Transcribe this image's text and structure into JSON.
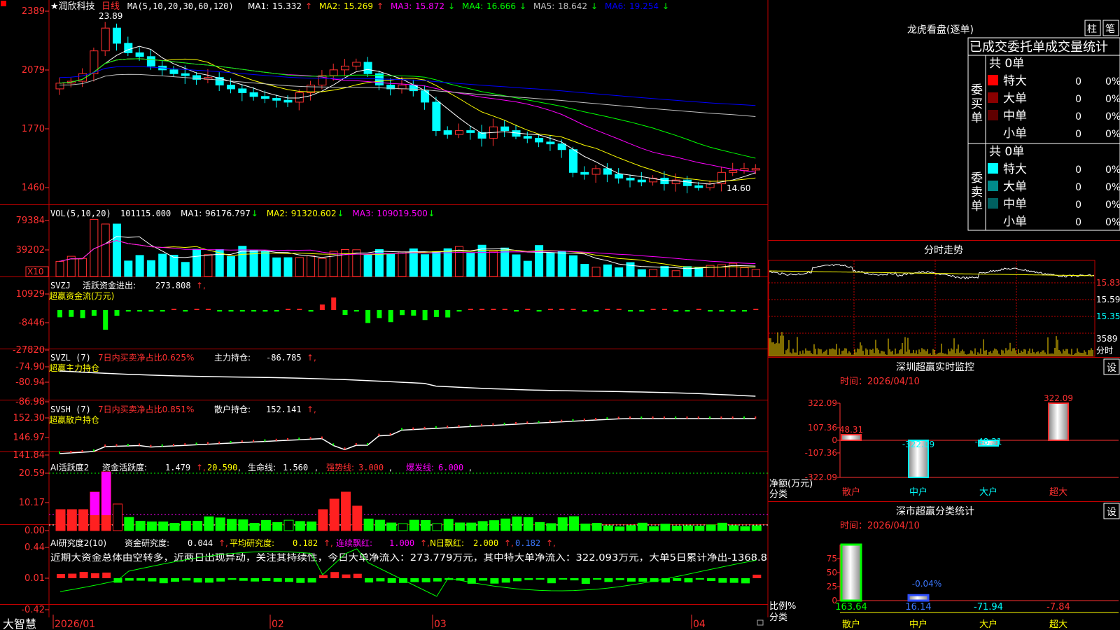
{
  "colors": {
    "up": "#ff3030",
    "down": "#00ffff",
    "vol_up": "#ff3030",
    "vol_down": "#00ffff",
    "ma1": "#ffffff",
    "ma2": "#ffff00",
    "ma3": "#ff00ff",
    "ma4": "#00ff00",
    "ma5": "#c0c0c0",
    "ma6": "#0000ff",
    "pos": "#ff2020",
    "neg": "#00ff00",
    "axis_text": "#ff3030",
    "border": "#ff0000"
  },
  "main": {
    "title": "★润欣科技",
    "period": "日线",
    "ma_header": "MA(5,10,20,30,60,120)",
    "ma": [
      {
        "label": "MA1:",
        "value": "15.332",
        "arrow": "↑",
        "color": "#ffffff"
      },
      {
        "label": "MA2:",
        "value": "15.269",
        "arrow": "↑",
        "color": "#ffff00"
      },
      {
        "label": "MA3:",
        "value": "15.872",
        "arrow": "↓",
        "color": "#ff00ff"
      },
      {
        "label": "MA4:",
        "value": "16.666",
        "arrow": "↓",
        "color": "#00ff00"
      },
      {
        "label": "MA5:",
        "value": "18.642",
        "arrow": "↓",
        "color": "#c0c0c0"
      },
      {
        "label": "MA6:",
        "value": "19.254",
        "arrow": "↓",
        "color": "#0000ff"
      }
    ],
    "y_ticks": [
      "2389",
      "2079",
      "1770",
      "1460"
    ],
    "high_label": "23.89",
    "low_label": "14.60"
  },
  "vol": {
    "header": "VOL(5,10,20)",
    "value": "101115.000",
    "ma": [
      {
        "label": "MA1:",
        "value": "96176.797",
        "arrow": "↓",
        "color": "#ffffff"
      },
      {
        "label": "MA2:",
        "value": "91320.602",
        "arrow": "↓",
        "color": "#ffff00"
      },
      {
        "label": "MA3:",
        "value": "109019.500",
        "arrow": "↓",
        "color": "#ff00ff"
      }
    ],
    "y_ticks": [
      "79384",
      "39202"
    ],
    "unit": "X10"
  },
  "svzj": {
    "header": "SVZJ",
    "label": "活跃资金进出:",
    "value": "273.808",
    "subtitle": "超赢资金流(万元)",
    "y_ticks": [
      "10929",
      "-8446",
      "-27820"
    ]
  },
  "svzl": {
    "header": "SVZL (7)",
    "stat": "7日内买卖净占比0.625%",
    "label": "主力持仓:",
    "value": "-86.785",
    "subtitle": "超赢主力持仓",
    "y_ticks": [
      "-74.90",
      "-80.94",
      "-86.98"
    ]
  },
  "svsh": {
    "header": "SVSH (7)",
    "stat": "7日内买卖净占比0.851%",
    "label": "散户持仓:",
    "value": "152.141",
    "subtitle": "超赢散户持仓",
    "y_ticks": [
      "152.30",
      "146.97",
      "141.84"
    ]
  },
  "ai1": {
    "header": "AI活跃度2",
    "label": "资金活跃度:",
    "value": "1.479",
    "value2": "20.590",
    "label3": "生命线:",
    "value3": "1.560",
    "label4": "强势线:",
    "value4": "3.000",
    "label5": "爆发线:",
    "value5": "6.000",
    "y_ticks": [
      "20.59",
      "10.17",
      "0.00"
    ]
  },
  "ai2": {
    "header": "AI研究度2(10)",
    "label": "资金研究度:",
    "value": "0.044",
    "label2": "平均研究度:",
    "value2": "0.182",
    "label3": "连续飘红:",
    "value3": "1.000",
    "label4": "N日飘红:",
    "value4": "2.000",
    "value5": "0.182",
    "y_ticks": [
      "0.44",
      "0.01",
      "-0.42"
    ],
    "comment": "近期大资金总体由空转多，近两日出现异动，关注其持续性，今日大单净流入：273.779万元，其中特大单净流入：322.093万元，大单5日累计净出-1368.8"
  },
  "bottom": {
    "brand": "大智慧",
    "dates": [
      "2026/01",
      "02",
      "03",
      "04"
    ]
  },
  "lhb": {
    "title": "龙虎看盘(逐单)",
    "btn1": "柱",
    "btn2": "笔",
    "header": "已成交委托单成交量统计",
    "buy": {
      "side": "委买单",
      "total": "共 0单",
      "rows": [
        {
          "name": "特大",
          "count": "0",
          "pct": "0%",
          "color": "#ff0000"
        },
        {
          "name": "大单",
          "count": "0",
          "pct": "0%",
          "color": "#8b0000"
        },
        {
          "name": "中单",
          "count": "0",
          "pct": "0%",
          "color": "#600000"
        },
        {
          "name": "小单",
          "count": "0",
          "pct": "0%",
          "color": "#000000"
        }
      ]
    },
    "sell": {
      "side": "委卖单",
      "total": "共 0单",
      "rows": [
        {
          "name": "特大",
          "count": "0",
          "pct": "0%",
          "color": "#00ffff"
        },
        {
          "name": "大单",
          "count": "0",
          "pct": "0%",
          "color": "#008b8b"
        },
        {
          "name": "中单",
          "count": "0",
          "pct": "0%",
          "color": "#006060"
        },
        {
          "name": "小单",
          "count": "0",
          "pct": "0%",
          "color": "#000000"
        }
      ]
    }
  },
  "fs": {
    "title": "分时走势",
    "y_ticks": [
      "15.83",
      "15.59",
      "15.35"
    ],
    "vol_tick": "3589",
    "vol_unit": "分时"
  },
  "monitor": {
    "title": "深圳超赢实时监控",
    "btn": "设",
    "date_label": "时间：2026/04/10",
    "y_ticks": [
      "322.09",
      "107.36",
      "0",
      "-107.36",
      "-322.09"
    ],
    "ylabel1": "净额(万元)",
    "ylabel2": "分类",
    "categories": [
      "散户",
      "中户",
      "大户",
      "超大"
    ],
    "values": [
      48.31,
      -322.09,
      -48.31,
      322.09
    ],
    "value_labels": [
      "48.31",
      "-322.09",
      "-48.31",
      "322.09"
    ]
  },
  "classstat": {
    "title": "深市超赢分类统计",
    "btn": "设",
    "date_label": "时间：2026/04/10",
    "y_ticks": [
      "75",
      "50",
      "25",
      "0"
    ],
    "ylabel1": "比例%",
    "ylabel2": "分类",
    "categories": [
      "散户",
      "中户",
      "大户",
      "超大"
    ],
    "values": [
      163.64,
      16.14,
      -71.94,
      -7.84
    ],
    "value_labels": [
      "163.64",
      "16.14",
      "-71.94",
      "-7.84"
    ],
    "bar_label": "-0.04%"
  },
  "chart_data": [
    {
      "type": "line",
      "series": [
        {
          "name": "MA1",
          "values": [
            15.332
          ]
        },
        {
          "name": "MA2",
          "values": [
            15.269
          ]
        },
        {
          "name": "MA3",
          "values": [
            15.872
          ]
        },
        {
          "name": "MA4",
          "values": [
            16.666
          ]
        },
        {
          "name": "MA5",
          "values": [
            18.642
          ]
        },
        {
          "name": "MA6",
          "values": [
            19.254
          ]
        }
      ],
      "ylim": [
        14.6,
        23.89
      ]
    },
    {
      "type": "bar",
      "categories": [
        "散户",
        "中户",
        "大户",
        "超大"
      ],
      "values": [
        48.31,
        -322.09,
        -48.31,
        322.09
      ],
      "ylim": [
        -322.09,
        322.09
      ],
      "ylabel": "净额(万元)",
      "xlabel": "分类"
    },
    {
      "type": "bar",
      "categories": [
        "散户",
        "中户",
        "大户",
        "超大"
      ],
      "values": [
        163.64,
        16.14,
        -71.94,
        -7.84
      ],
      "ylabel": "比例%",
      "xlabel": "分类"
    }
  ]
}
